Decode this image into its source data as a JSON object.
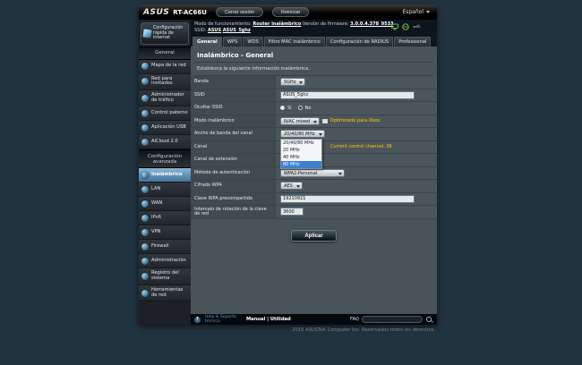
{
  "colors": {
    "hint_orange": "#ffcc00",
    "link_blue": "#4f9fd0",
    "status_green": "#6ec04a",
    "highlight_blue": "#3f7fd2",
    "active_item_blue": "#6ca0c4"
  },
  "header": {
    "brand": "ASUS",
    "model": "RT-AC66U",
    "logout": "Cerrar sesión",
    "reboot": "Reiniciar",
    "language": "Español"
  },
  "infobar": {
    "mode_label": "Modo de funcionamiento:",
    "mode_value": "Router inalámbrico",
    "firmware_label": "Versión de firmware:",
    "firmware_value": "3.0.0.4.378_9533",
    "ssid_label": "SSID:",
    "ssid_1": "ASUS",
    "ssid_2": "ASUS_5ghz"
  },
  "qis": {
    "label": "Configuración rápida de Internet"
  },
  "tabs": {
    "t0": "General",
    "t1": "WPS",
    "t2": "WDS",
    "t3": "Filtro MAC inalámbrico",
    "t4": "Configuración de RADIUS",
    "t5": "Professional"
  },
  "sidebar": {
    "sections": [
      {
        "header": "General",
        "items": [
          {
            "label": "Mapa de la red"
          },
          {
            "label": "Red para invitados"
          },
          {
            "label": "Administrador de tráfico"
          },
          {
            "label": "Control paterno"
          },
          {
            "label": "Aplicación USB"
          },
          {
            "label": "AiCloud 2.0"
          }
        ]
      },
      {
        "header": "Configuración avanzada",
        "items": [
          {
            "label": "Inalámbrico"
          },
          {
            "label": "LAN"
          },
          {
            "label": "WAN"
          },
          {
            "label": "IPv6"
          },
          {
            "label": "VPN"
          },
          {
            "label": "Firewall"
          },
          {
            "label": "Administración"
          },
          {
            "label": "Registro del sistema"
          },
          {
            "label": "Herramientas de red"
          }
        ]
      }
    ]
  },
  "main": {
    "title": "Inalámbrico - General",
    "subtitle": "Establezca la siguiente información inalámbrica.",
    "apply": "Aplicar",
    "fields": [
      {
        "label": "Banda",
        "value": "5GHz"
      },
      {
        "label": "SSID",
        "value": "ASUS_5ghz"
      },
      {
        "label": "Ocultar SSID",
        "yes": "Sí",
        "no": "No",
        "selected": "Sí"
      },
      {
        "label": "Modo inalámbrico",
        "value": "N/AC mixed",
        "checkbox": "Optimizado para Xbox"
      },
      {
        "label": "Ancho de banda del canal",
        "value": "20/40/80 MHz"
      },
      {
        "label": "Canal",
        "hint": "Current control channel: 36"
      },
      {
        "label": "Canal de extensión"
      },
      {
        "label": "Método de autenticación",
        "value": "WPA2-Personal"
      },
      {
        "label": "Cifrado WPA",
        "value": "AES"
      },
      {
        "label": "Clave WPA precompartida",
        "value": "19210921"
      },
      {
        "label": "Intervalo de rotación de la clave de red",
        "value": "3600"
      }
    ],
    "dropdown": {
      "o0": "20/40/80 MHz",
      "o1": "20 MHz",
      "o2": "40 MHz",
      "o3": "80 MHz",
      "highlighted": "80 MHz"
    }
  },
  "footer": {
    "help_line1": "Help & Soporte",
    "help_line2": "técnico",
    "manual": "Manual",
    "divider": "|",
    "utility": "Utilidad",
    "faq": "FAQ"
  },
  "copyright": "2015 ASUSTeK Computer Inc. Reservados todos los derechos."
}
